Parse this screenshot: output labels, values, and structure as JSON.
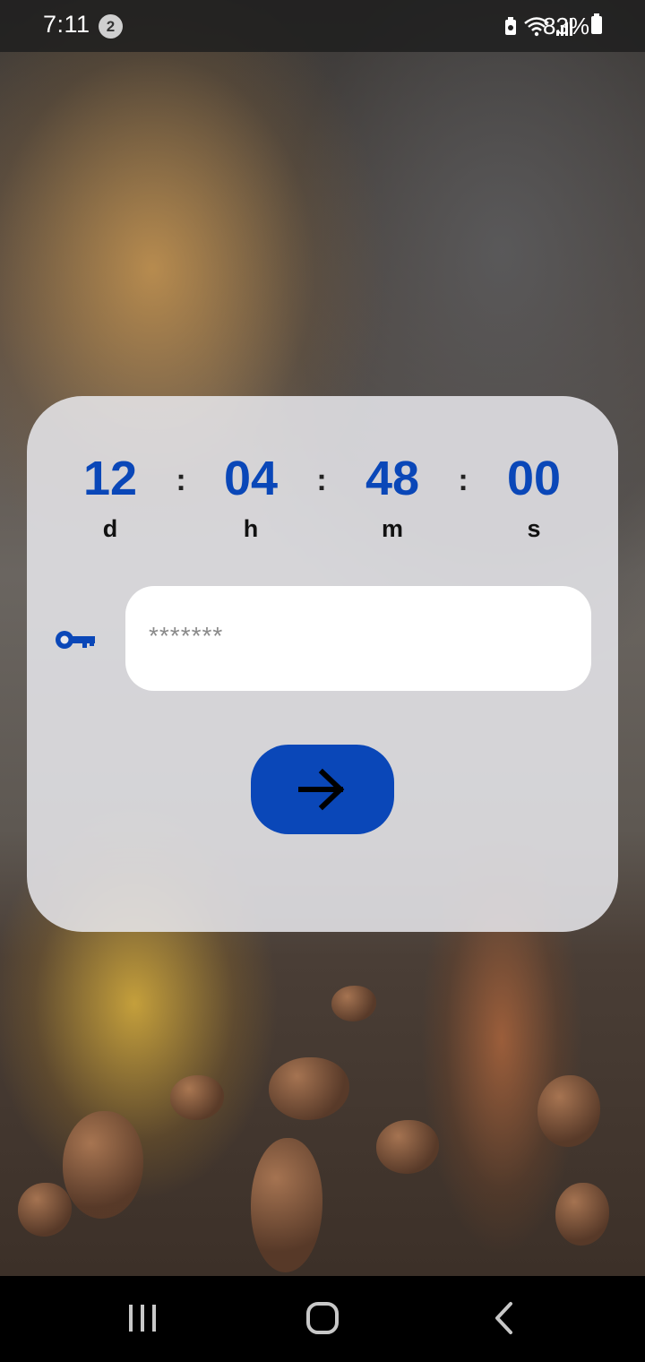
{
  "status_bar": {
    "time": "7:11",
    "notification_count": "2",
    "battery_percent": "83%",
    "icons": [
      "battery-saver-icon",
      "wifi-icon",
      "signal-icon",
      "battery-icon"
    ]
  },
  "countdown": {
    "days": "12",
    "hours": "04",
    "minutes": "48",
    "seconds": "00",
    "days_label": "d",
    "hours_label": "h",
    "minutes_label": "m",
    "seconds_label": "s",
    "separator": ":"
  },
  "password": {
    "placeholder": "*******",
    "value": ""
  },
  "submit": {
    "icon": "arrow-right-icon"
  },
  "nav_bar": {
    "buttons": [
      "recents-icon",
      "home-icon",
      "back-icon"
    ]
  },
  "colors": {
    "accent": "#0a47b8",
    "card_background": "#e8e8ec",
    "status_bar": "#1e1e1e",
    "nav_bar": "#000000"
  }
}
